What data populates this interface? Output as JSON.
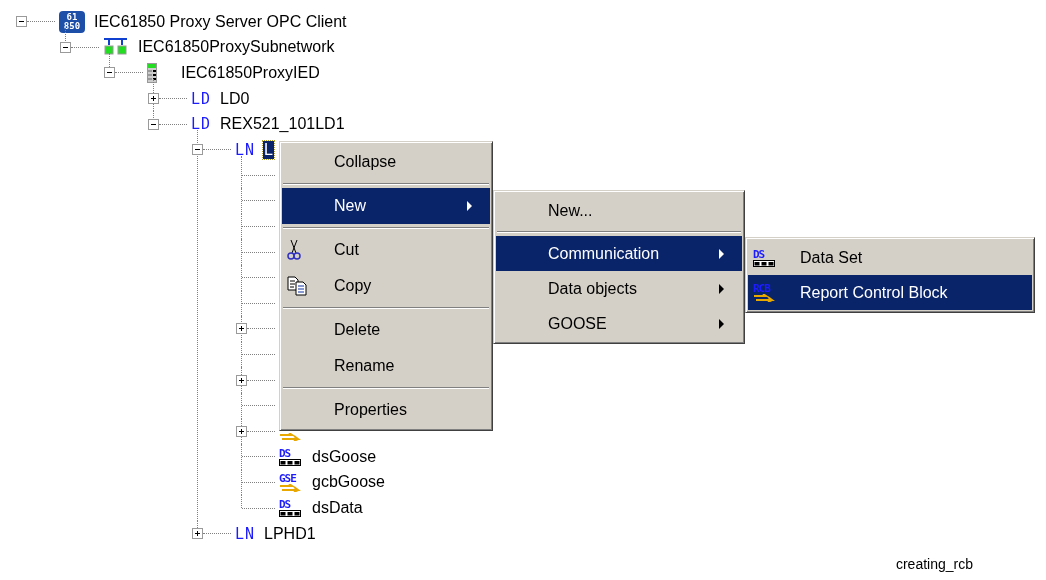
{
  "tree": [
    {
      "kind": "server",
      "badge": "61 850",
      "label": "IEC61850 Proxy Server OPC Client",
      "selected": false,
      "expanded": true,
      "children": [
        {
          "kind": "subnetwork",
          "label": "IEC61850ProxySubnetwork",
          "selected": false,
          "expanded": true,
          "children": [
            {
              "kind": "ied",
              "label": "IEC61850ProxyIED",
              "selected": false,
              "expanded": true,
              "children": [
                {
                  "kind": "ld",
                  "prefix": "LD",
                  "label": "LD0",
                  "selected": false,
                  "expanded": false
                },
                {
                  "kind": "ld",
                  "prefix": "LD",
                  "label": "REX521_101LD1",
                  "selected": false,
                  "expanded": true,
                  "children": [
                    {
                      "kind": "ln",
                      "prefix": "LN",
                      "label": "L",
                      "selected": true,
                      "expanded": true,
                      "children": [
                        {
                          "kind": "covered"
                        },
                        {
                          "kind": "covered"
                        },
                        {
                          "kind": "covered"
                        },
                        {
                          "kind": "covered"
                        },
                        {
                          "kind": "covered"
                        },
                        {
                          "kind": "covered"
                        },
                        {
                          "kind": "covered",
                          "expanded": false
                        },
                        {
                          "kind": "covered"
                        },
                        {
                          "kind": "covered",
                          "expanded": false
                        },
                        {
                          "kind": "covered"
                        },
                        {
                          "kind": "rcb",
                          "expanded": false
                        },
                        {
                          "kind": "dataset",
                          "badge": "DS",
                          "label": "dsGoose",
                          "selected": false
                        },
                        {
                          "kind": "gse",
                          "badge": "GSE",
                          "label": "gcbGoose",
                          "selected": false
                        },
                        {
                          "kind": "dataset",
                          "badge": "DS",
                          "label": "dsData",
                          "selected": false
                        }
                      ]
                    },
                    {
                      "kind": "ln",
                      "prefix": "LN",
                      "label": "LPHD1",
                      "selected": false,
                      "expanded": false
                    }
                  ]
                }
              ]
            }
          ]
        }
      ]
    }
  ],
  "menus": [
    {
      "items": [
        {
          "kind": "item",
          "label": "Collapse",
          "submenu": false,
          "selected": false
        },
        {
          "kind": "separator"
        },
        {
          "kind": "item",
          "label": "New",
          "submenu": true,
          "selected": true
        },
        {
          "kind": "separator"
        },
        {
          "kind": "cut",
          "label": "Cut",
          "submenu": false,
          "selected": false
        },
        {
          "kind": "copy",
          "label": "Copy",
          "submenu": false,
          "selected": false
        },
        {
          "kind": "separator"
        },
        {
          "kind": "item",
          "label": "Delete",
          "submenu": false,
          "selected": false
        },
        {
          "kind": "item",
          "label": "Rename",
          "submenu": false,
          "selected": false
        },
        {
          "kind": "separator"
        },
        {
          "kind": "item",
          "label": "Properties",
          "submenu": false,
          "selected": false
        }
      ]
    },
    {
      "items": [
        {
          "kind": "item",
          "label": "New...",
          "submenu": false,
          "selected": false
        },
        {
          "kind": "separator"
        },
        {
          "kind": "item",
          "label": "Communication",
          "submenu": true,
          "selected": true
        },
        {
          "kind": "item",
          "label": "Data objects",
          "submenu": true,
          "selected": false
        },
        {
          "kind": "item",
          "label": "GOOSE",
          "submenu": true,
          "selected": false
        }
      ]
    },
    {
      "items": [
        {
          "kind": "dataset",
          "badge": "DS",
          "label": "Data Set",
          "submenu": false,
          "selected": false
        },
        {
          "kind": "rcb",
          "badge": "RCB",
          "label": "Report Control Block",
          "submenu": false,
          "selected": true
        }
      ]
    }
  ],
  "caption": "creating_rcb"
}
